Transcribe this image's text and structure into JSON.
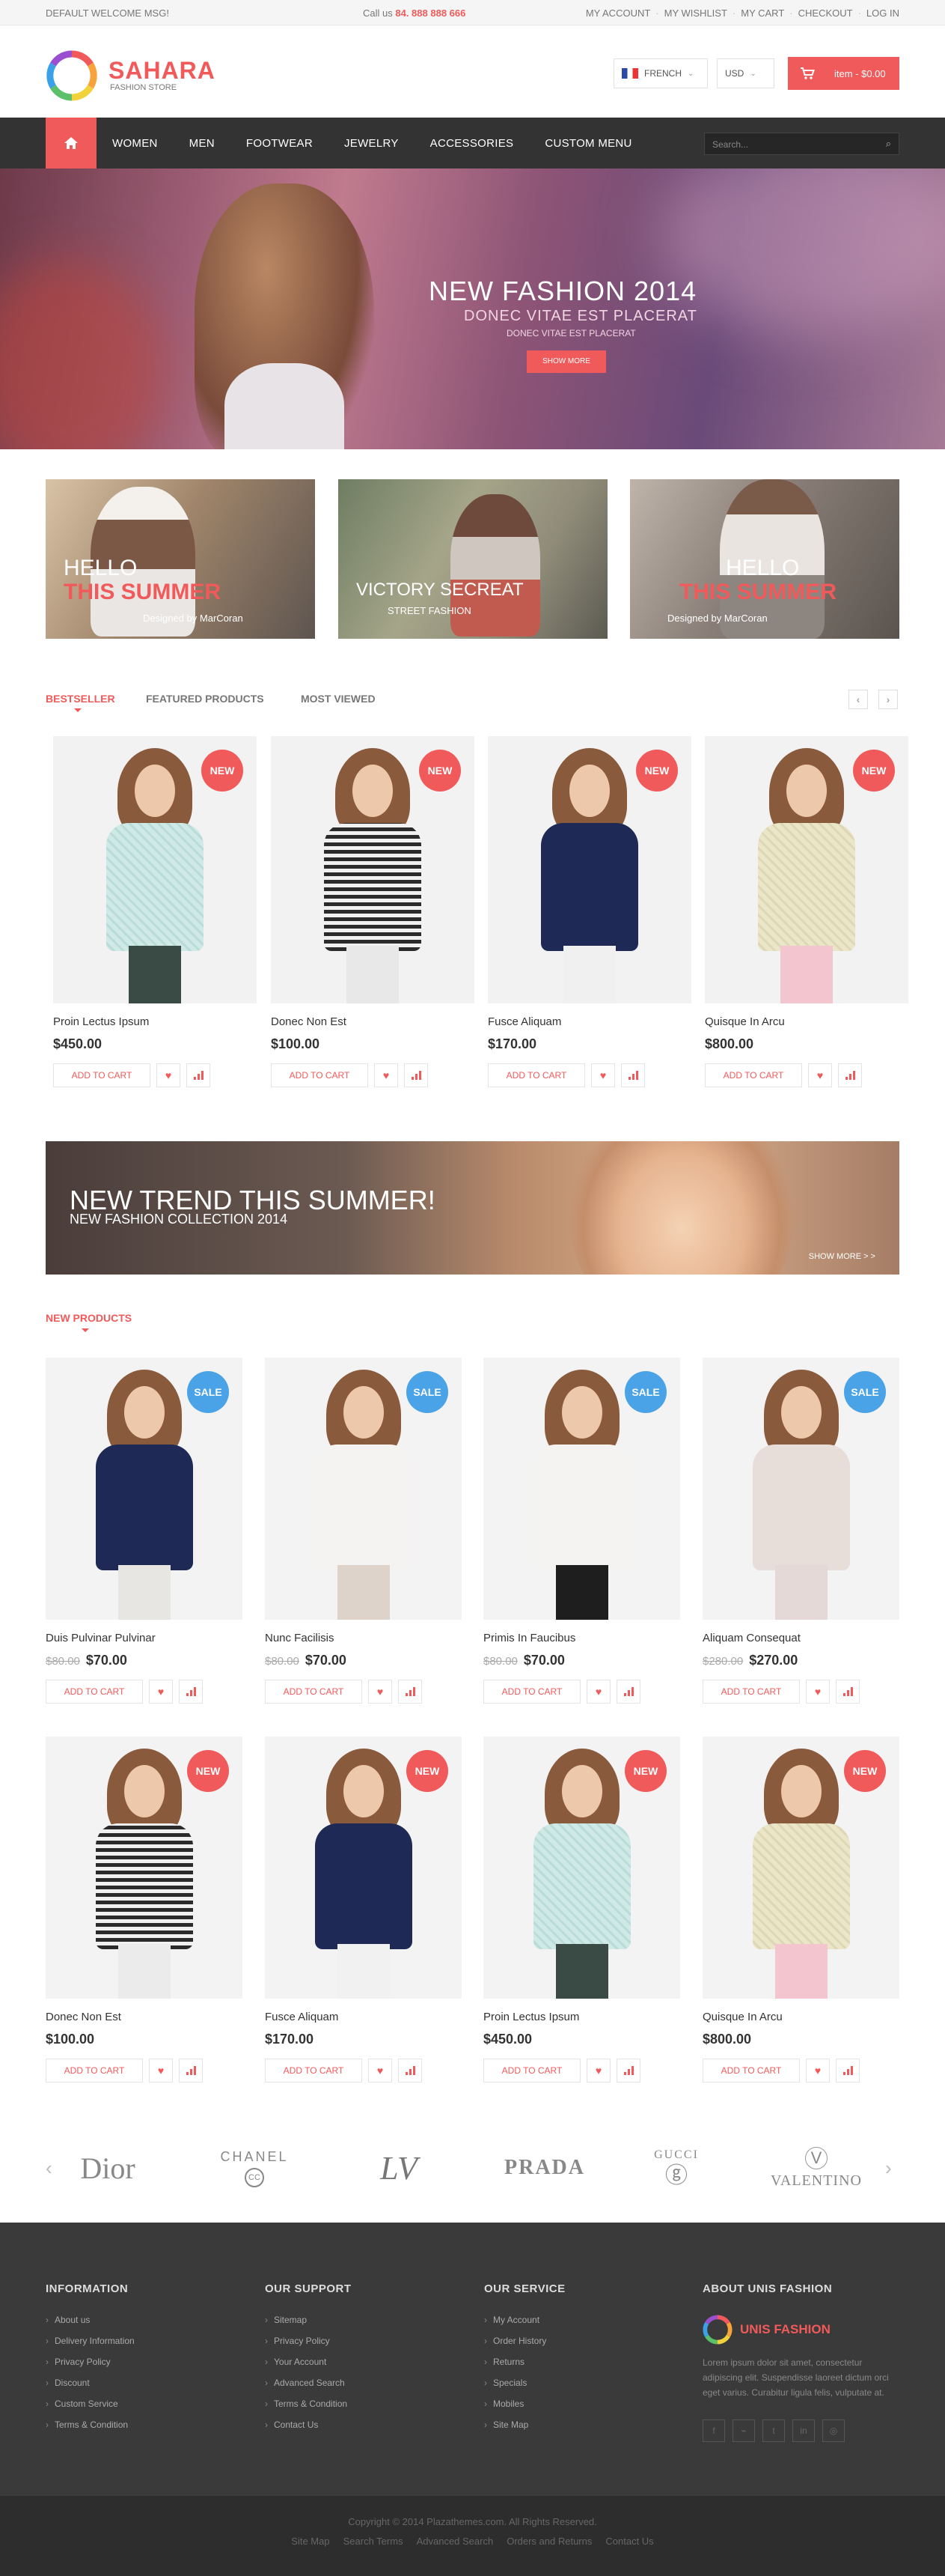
{
  "topbar": {
    "welcome": "DEFAULT WELCOME MSG!",
    "call_label": "Call us",
    "phone": "84. 888 888 666",
    "links": [
      "MY ACCOUNT",
      "MY WISHLIST",
      "MY CART",
      "CHECKOUT",
      "LOG IN"
    ]
  },
  "header": {
    "brand": "SAHARA",
    "tagline": "FASHION STORE",
    "language": "FRENCH",
    "currency": "USD",
    "cart": "item - $0.00"
  },
  "nav": {
    "items": [
      "WOMEN",
      "MEN",
      "FOOTWEAR",
      "JEWELRY",
      "ACCESSORIES",
      "CUSTOM MENU"
    ],
    "search_placeholder": "Search..."
  },
  "hero": {
    "title": "NEW FASHION 2014",
    "subtitle": "DONEC VITAE EST PLACERAT",
    "small": "DONEC VITAE EST PLACERAT",
    "button": "SHOW MORE"
  },
  "banners": [
    {
      "line1": "HELLO",
      "line2": "THIS SUMMER",
      "line3": "Designed by MarCoran"
    },
    {
      "line1": "VICTORY SECREAT",
      "line2": "",
      "line3": "STREET FASHION"
    },
    {
      "line1": "HELLO",
      "line2": "THIS SUMMER",
      "line3": "Designed by MarCoran"
    }
  ],
  "tabs": {
    "items": [
      "BESTSELLER",
      "FEATURED PRODUCTS",
      "MOST VIEWED"
    ]
  },
  "bestseller": [
    {
      "name": "Proin Lectus Ipsum",
      "price": "$450.00",
      "badge": "NEW",
      "top": "mint",
      "bottom": "#3a4a44"
    },
    {
      "name": "Donec Non Est",
      "price": "$100.00",
      "badge": "NEW",
      "top": "stripe",
      "bottom": "#e8e8e8"
    },
    {
      "name": "Fusce Aliquam",
      "price": "$170.00",
      "badge": "NEW",
      "top": "navy",
      "bottom": "#f0f0f0"
    },
    {
      "name": "Quisque In Arcu",
      "price": "$800.00",
      "badge": "NEW",
      "top": "cream",
      "bottom": "#f3c6cf"
    }
  ],
  "actions": {
    "add": "ADD TO CART"
  },
  "trend": {
    "title": "NEW TREND THIS SUMMER!",
    "subtitle": "NEW FASHION COLLECTION 2014",
    "more": "SHOW MORE > >"
  },
  "new_products": {
    "title": "NEW PRODUCTS",
    "row1": [
      {
        "name": "Duis Pulvinar Pulvinar",
        "old": "$80.00",
        "price": "$70.00",
        "badge": "SALE",
        "top": "navy",
        "bottom": "#e8e6e2"
      },
      {
        "name": "Nunc Facilisis",
        "old": "$80.00",
        "price": "$70.00",
        "badge": "SALE",
        "top": "white",
        "bottom": "#ddd3cb"
      },
      {
        "name": "Primis In Faucibus",
        "old": "$80.00",
        "price": "$70.00",
        "badge": "SALE",
        "top": "white",
        "bottom": "#1e1e1e"
      },
      {
        "name": "Aliquam Consequat",
        "old": "$280.00",
        "price": "$270.00",
        "badge": "SALE",
        "top": "coat",
        "bottom": "#e4d9d6"
      }
    ],
    "row2": [
      {
        "name": "Donec Non Est",
        "old": "",
        "price": "$100.00",
        "badge": "NEW",
        "top": "stripe",
        "bottom": "#ebebeb"
      },
      {
        "name": "Fusce Aliquam",
        "old": "",
        "price": "$170.00",
        "badge": "NEW",
        "top": "navy",
        "bottom": "#f1f1f1"
      },
      {
        "name": "Proin Lectus Ipsum",
        "old": "",
        "price": "$450.00",
        "badge": "NEW",
        "top": "mint",
        "bottom": "#3a4a44"
      },
      {
        "name": "Quisque In Arcu",
        "old": "",
        "price": "$800.00",
        "badge": "NEW",
        "top": "cream",
        "bottom": "#f3c6cf"
      }
    ]
  },
  "brands": [
    "Dior",
    "CHANEL",
    "LV",
    "PRADA",
    "GUCCI",
    "VALENTINO"
  ],
  "footer": {
    "information": {
      "title": "INFORMATION",
      "links": [
        "About us",
        "Delivery Information",
        "Privacy Policy",
        "Discount",
        "Custom Service",
        "Terms & Condition"
      ]
    },
    "support": {
      "title": "OUR SUPPORT",
      "links": [
        "Sitemap",
        "Privacy Policy",
        "Your Account",
        "Advanced Search",
        "Terms & Condition",
        "Contact Us"
      ]
    },
    "service": {
      "title": "OUR SERVICE",
      "links": [
        "My Account",
        "Order History",
        "Returns",
        "Specials",
        "Mobiles",
        "Site Map"
      ]
    },
    "about": {
      "title": "ABOUT UNIS FASHION",
      "brand": "UNIS FASHION",
      "text": "Lorem ipsum dolor sit amet, consectetur adipiscing elit. Suspendisse laoreet dictum orci eget varius. Curabitur ligula felis, vulputate at."
    },
    "copyright": "Copyright © 2014 Plazathemes.com. All Rights Reserved.",
    "bottom_links": [
      "Site Map",
      "Search Terms",
      "Advanced Search",
      "Orders and Returns",
      "Contact Us"
    ]
  },
  "colors": {
    "accent": "#f15a5a",
    "sale": "#4aa3e6",
    "dark": "#333333"
  }
}
